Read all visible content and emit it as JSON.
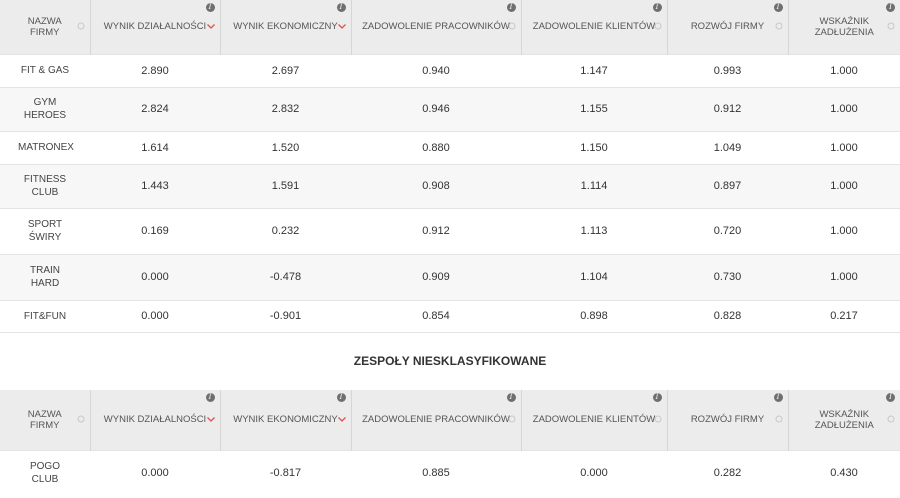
{
  "headers": [
    {
      "label": "NAZWA FIRMY",
      "info": false,
      "sort": "neutral"
    },
    {
      "label": "WYNIK DZIAŁALNOŚCI",
      "info": true,
      "sort": "desc"
    },
    {
      "label": "WYNIK EKONOMICZNY",
      "info": true,
      "sort": "desc"
    },
    {
      "label": "ZADOWOLENIE PRACOWNIKÓW",
      "info": true,
      "sort": "neutral"
    },
    {
      "label": "ZADOWOLENIE KLIENTÓW",
      "info": true,
      "sort": "neutral"
    },
    {
      "label": "ROZWÓJ FIRMY",
      "info": true,
      "sort": "neutral"
    },
    {
      "label": "WSKAŹNIK ZADŁUŻENIA",
      "info": true,
      "sort": "neutral"
    }
  ],
  "bottom_headers": [
    {
      "label": "NAZWA FIRMY",
      "info": false,
      "sort": "neutral"
    },
    {
      "label": "WYNIK DZIAŁALNOŚCI",
      "info": true,
      "sort": "desc"
    },
    {
      "label": "WYNIK EKONOMICZNY",
      "info": true,
      "sort": "desc"
    },
    {
      "label": "ZADOWOLENIE PRACOWNIKÓW",
      "info": true,
      "sort": "neutral"
    },
    {
      "label": "ZADOWOLENIE KLIENTÓW",
      "info": true,
      "sort": "neutral"
    },
    {
      "label": "ROZWÓJ FIRMY",
      "info": true,
      "sort": "neutral"
    },
    {
      "label": "WSKAŹNIK ZADŁUŻENIA",
      "info": true,
      "sort": "neutral"
    }
  ],
  "info_glyph": "i",
  "icons": {
    "info": "info-icon",
    "sort_desc": "chevron-down-icon",
    "sort_neutral": "sort-neutral-icon"
  },
  "colors": {
    "sort_active": "#d9534f",
    "sort_neutral": "#c8c8c8",
    "header_bg": "#ececec",
    "row_alt": "#f7f7f7"
  },
  "classified": [
    {
      "name": "FIT & GAS",
      "values": [
        "2.890",
        "2.697",
        "0.940",
        "1.147",
        "0.993",
        "1.000"
      ],
      "height": 33
    },
    {
      "name": "GYM HEROES",
      "values": [
        "2.824",
        "2.832",
        "0.946",
        "1.155",
        "0.912",
        "1.000"
      ],
      "height": 44
    },
    {
      "name": "MATRONEX",
      "values": [
        "1.614",
        "1.520",
        "0.880",
        "1.150",
        "1.049",
        "1.000"
      ],
      "height": 33
    },
    {
      "name": "FITNESS CLUB",
      "values": [
        "1.443",
        "1.591",
        "0.908",
        "1.114",
        "0.897",
        "1.000"
      ],
      "height": 44
    },
    {
      "name": "SPORT ŚWIRY",
      "values": [
        "0.169",
        "0.232",
        "0.912",
        "1.113",
        "0.720",
        "1.000"
      ],
      "height": 46
    },
    {
      "name": "TRAIN HARD",
      "values": [
        "0.000",
        "-0.478",
        "0.909",
        "1.104",
        "0.730",
        "1.000"
      ],
      "height": 46
    },
    {
      "name": "FIT&FUN",
      "values": [
        "0.000",
        "-0.901",
        "0.854",
        "0.898",
        "0.828",
        "0.217"
      ],
      "height": 32
    }
  ],
  "unclassified_title": "ZESPOŁY NIESKLASYFIKOWANE",
  "unclassified": [
    {
      "name": "POGO CLUB",
      "values": [
        "0.000",
        "-0.817",
        "0.885",
        "0.000",
        "0.282",
        "0.430"
      ],
      "height": 45
    }
  ]
}
